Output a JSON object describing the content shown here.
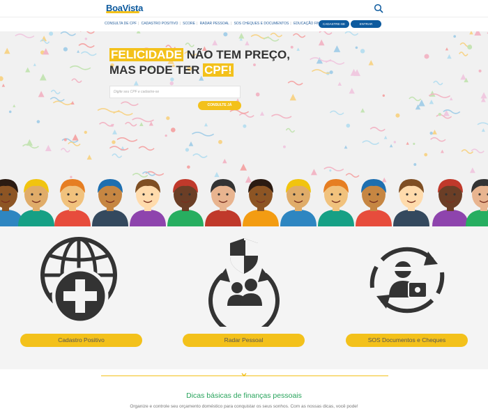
{
  "header": {
    "logo": "BoaVista",
    "search_icon": "search-icon"
  },
  "nav": {
    "links": [
      "CONSULTA DE CPF",
      "CADASTRO POSITIVO",
      "SCORE",
      "RADAR PESSOAL",
      "SOS CHEQUES E DOCUMENTOS",
      "EDUCAÇÃO FINANCEIRA"
    ],
    "cadastre_label": "CADASTRE-SE",
    "entrar_label": "ENTRAR"
  },
  "hero": {
    "line1_highlight": "FELICIDADE",
    "line1_rest": " NÃO TEM PREÇO,",
    "line2_rest": "MAS PODE TER ",
    "line2_highlight": "CPF!",
    "input_placeholder": "Digite seu CPF e cadastre-se",
    "button_label": "CONSULTE JÁ"
  },
  "features": [
    {
      "label": "Cadastro Positivo",
      "icon": "globe-plus-icon"
    },
    {
      "label": "Radar Pessoal",
      "icon": "shield-people-icon"
    },
    {
      "label": "SOS Documentos e Cheques",
      "icon": "thief-document-icon"
    }
  ],
  "tips": {
    "title": "Dicas básicas de finanças pessoais",
    "text": "Organize e controle seu orçamento doméstico para conquistar os seus sonhos. Com as nossas dicas, você pode!"
  },
  "colors": {
    "brand_blue": "#0d5a9e",
    "accent_yellow": "#f3c11b",
    "green": "#27a35b"
  }
}
